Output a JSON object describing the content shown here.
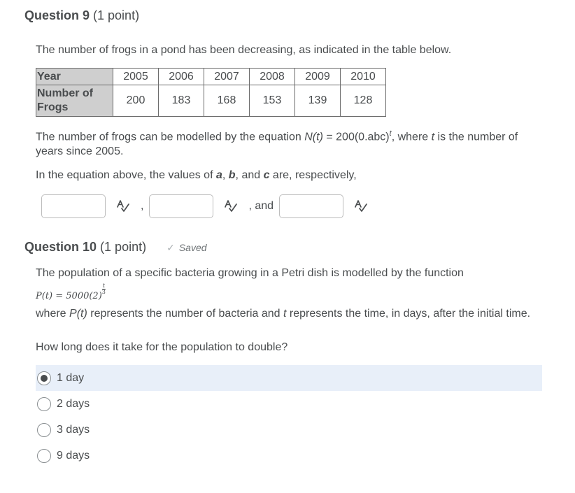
{
  "question9": {
    "title": "Question 9",
    "points": "(1 point)",
    "intro": "The number of frogs in a pond has been decreasing, as indicated in the table below.",
    "table": {
      "row_headers": [
        "Year",
        "Number of Frogs"
      ],
      "years": [
        "2005",
        "2006",
        "2007",
        "2008",
        "2009",
        "2010"
      ],
      "frogs": [
        "200",
        "183",
        "168",
        "153",
        "139",
        "128"
      ]
    },
    "model_text_1": "The number of frogs can be modelled by the equation ",
    "model_func": "N(t)",
    "model_eq": " = 200(0.abc)",
    "model_exp": "t",
    "model_text_2": ", where ",
    "model_var": "t",
    "model_text_3": " is the number of years since 2005.",
    "prompt_1": "In the equation above, the values of ",
    "var_a": "a",
    "comma1": ", ",
    "var_b": "b",
    "and_text": ", and ",
    "var_c": "c",
    "prompt_2": " are, respectively,",
    "answers": [
      {
        "value": "",
        "placeholder": ""
      },
      {
        "value": "",
        "placeholder": ""
      },
      {
        "value": "",
        "placeholder": ""
      }
    ],
    "separators": [
      ",",
      ", and"
    ],
    "spellcheck_icon": "spellcheck-icon"
  },
  "question10": {
    "title": "Question 10",
    "points": "(1 point)",
    "status": "Saved",
    "status_icon": "checkmark-icon",
    "intro": "The population of a specific bacteria growing in a Petri dish is modelled by the function",
    "formula_lhs": "P(t) = 5000(2)",
    "formula_exp_num": "t",
    "formula_exp_den": "3",
    "desc_1": "where ",
    "desc_func": "P(t)",
    "desc_2": " represents the number of bacteria and ",
    "desc_var": "t",
    "desc_3": " represents the time, in days, after the initial time.",
    "question": "How long does it take for the population to double?",
    "options": [
      {
        "label": "1 day",
        "selected": true
      },
      {
        "label": "2 days",
        "selected": false
      },
      {
        "label": "3 days",
        "selected": false
      },
      {
        "label": "9 days",
        "selected": false
      }
    ]
  }
}
